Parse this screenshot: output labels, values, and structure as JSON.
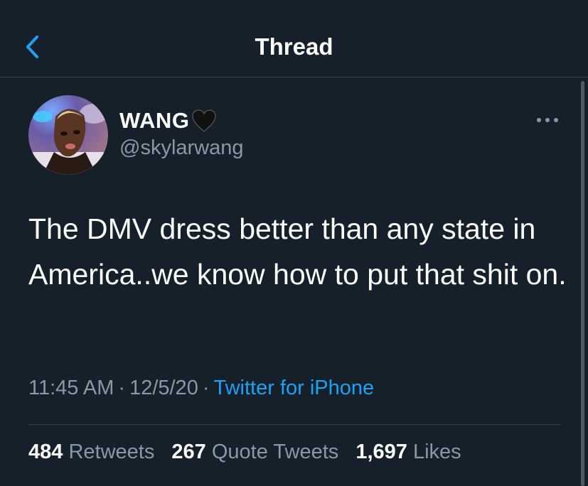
{
  "nav": {
    "title": "Thread",
    "back_icon": "chevron-left-icon"
  },
  "colors": {
    "background": "#15202b",
    "accent": "#1da1f2",
    "muted": "#8899a6",
    "divider": "#38444d"
  },
  "tweet": {
    "author": {
      "display_name": "WANG",
      "name_emoji": "black-heart-icon",
      "handle": "@skylarwang"
    },
    "more_icon": "more-horizontal-icon",
    "text": "The DMV dress better than any state in America..we know how to put that shit on.",
    "time": "11:45 AM",
    "date": "12/5/20",
    "separator": "·",
    "source": "Twitter for iPhone",
    "stats": {
      "retweets": {
        "count": "484",
        "label": "Retweets"
      },
      "quote_tweets": {
        "count": "267",
        "label": "Quote Tweets"
      },
      "likes": {
        "count": "1,697",
        "label": "Likes"
      }
    }
  }
}
